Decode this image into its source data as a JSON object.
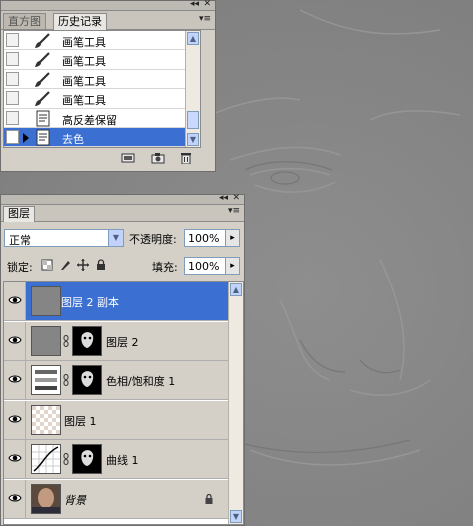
{
  "history_panel": {
    "tabs": [
      {
        "label": "直方图",
        "active": false
      },
      {
        "label": "历史记录",
        "active": true
      }
    ],
    "items": [
      {
        "label": "画笔工具",
        "icon": "brush-icon",
        "selected": false
      },
      {
        "label": "画笔工具",
        "icon": "brush-icon",
        "selected": false
      },
      {
        "label": "画笔工具",
        "icon": "brush-icon",
        "selected": false
      },
      {
        "label": "画笔工具",
        "icon": "brush-icon",
        "selected": false
      },
      {
        "label": "高反差保留",
        "icon": "history-step-icon",
        "selected": false
      },
      {
        "label": "去色",
        "icon": "history-step-icon",
        "selected": true
      }
    ],
    "footer_icons": [
      "new-document-from-state-icon",
      "snapshot-icon",
      "trash-icon"
    ]
  },
  "layers_panel": {
    "tab_label": "图层",
    "blend_mode": "正常",
    "opacity_label": "不透明度:",
    "opacity_value": "100%",
    "lock_label": "锁定:",
    "fill_label": "填充:",
    "fill_value": "100%",
    "layers": [
      {
        "name": "图层 2 副本",
        "selected": true,
        "italic": false,
        "thumb": "gray",
        "mask": false,
        "locked": false
      },
      {
        "name": "图层 2",
        "selected": false,
        "italic": false,
        "thumb": "gray",
        "mask": true,
        "locked": false
      },
      {
        "name": "色相/饱和度 1",
        "selected": false,
        "italic": false,
        "thumb": "adjustment-hue",
        "mask": true,
        "locked": false
      },
      {
        "name": "图层 1",
        "selected": false,
        "italic": false,
        "thumb": "transparent",
        "mask": false,
        "locked": false
      },
      {
        "name": "曲线 1",
        "selected": false,
        "italic": false,
        "thumb": "adjustment-curves",
        "mask": true,
        "locked": false
      },
      {
        "name": "背景",
        "selected": false,
        "italic": true,
        "thumb": "photo",
        "mask": false,
        "locked": true
      }
    ]
  },
  "colors": {
    "selection": "#3b6fd1",
    "panel_bg": "#d4d0c8",
    "canvas_gray": "#868686"
  }
}
